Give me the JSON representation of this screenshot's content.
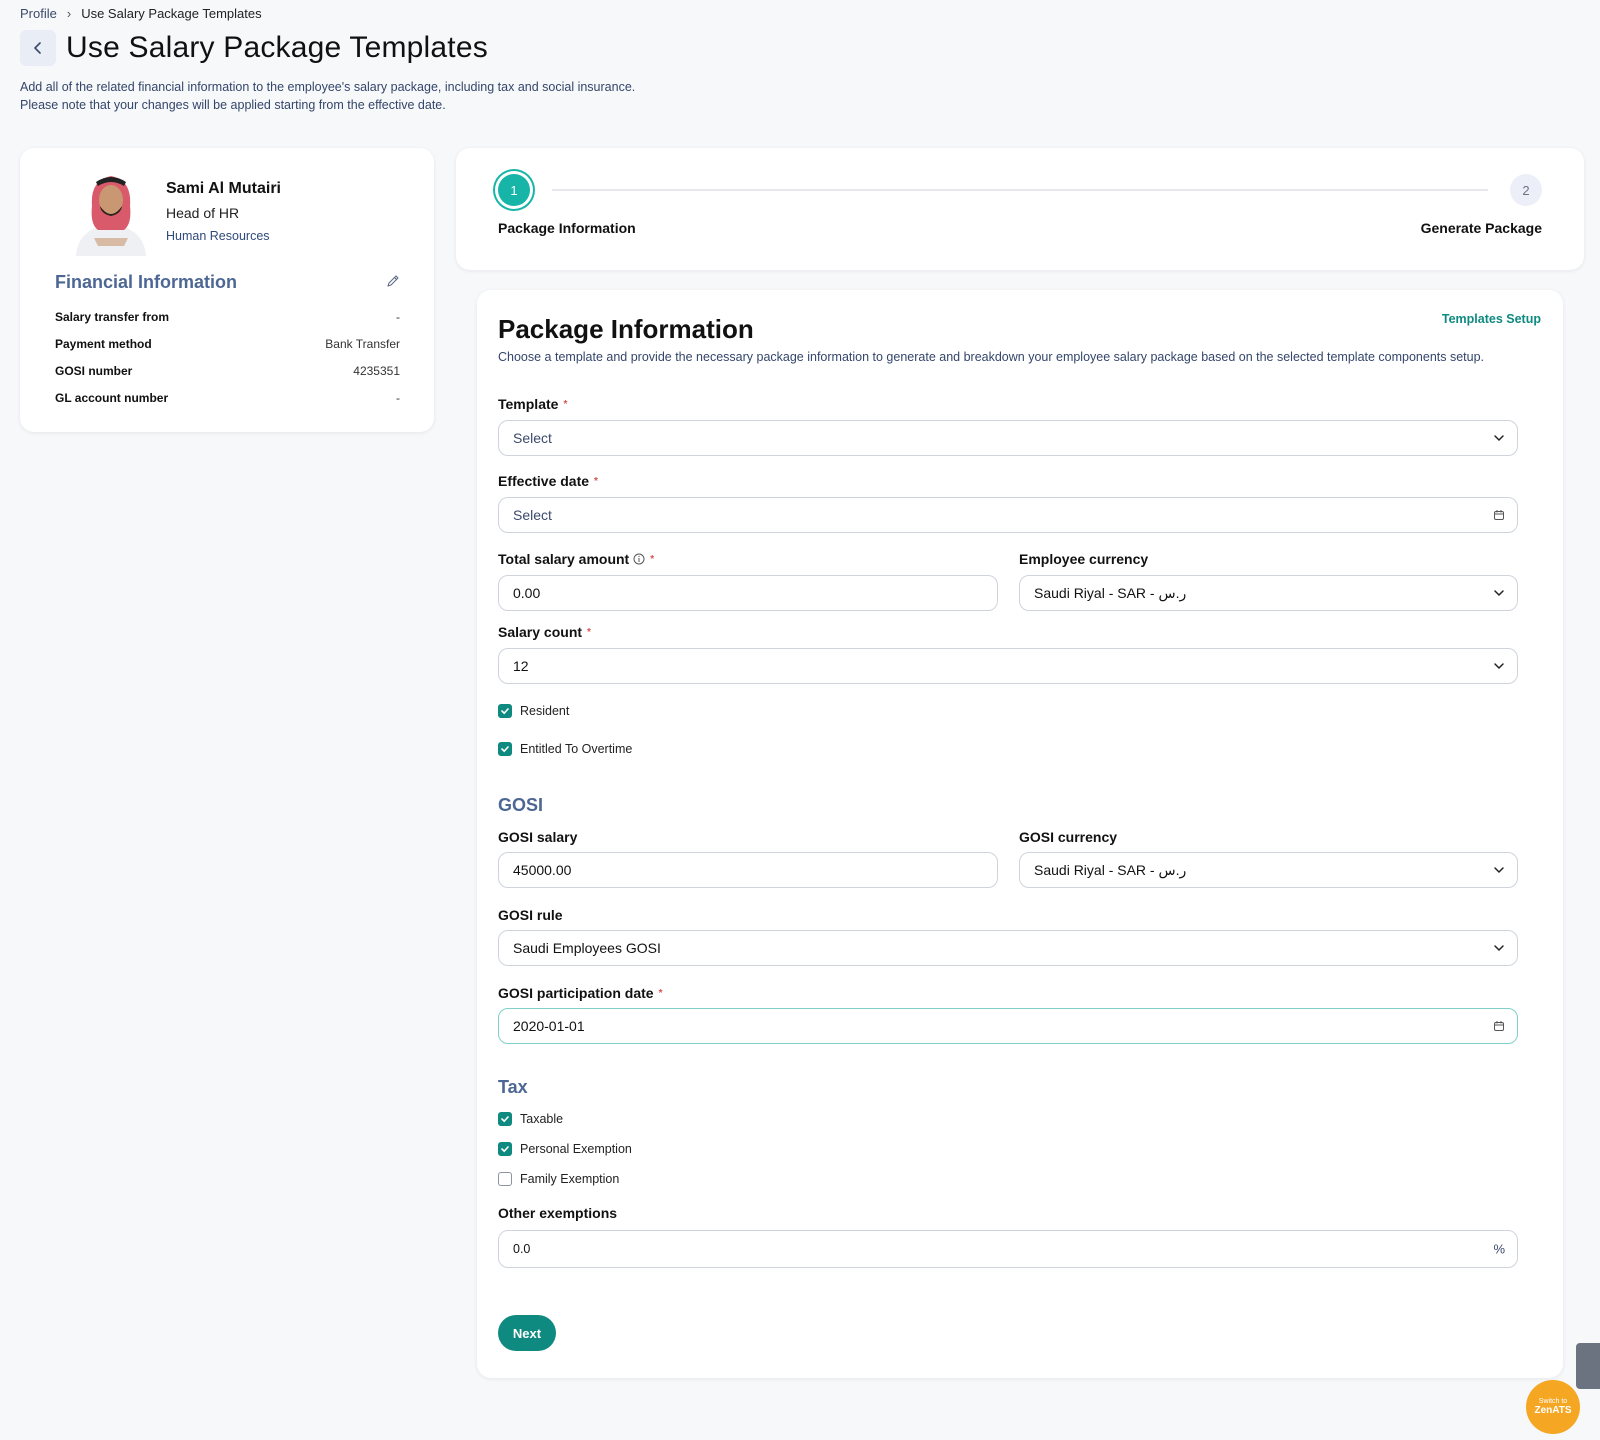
{
  "breadcrumb": {
    "parent": "Profile",
    "separator": "›",
    "current": "Use Salary Package Templates"
  },
  "page": {
    "title": "Use Salary Package Templates",
    "description": "Add all of the related financial information to the employee's salary package, including tax and social insurance. Please note that your changes will be applied starting from the effective date."
  },
  "employee": {
    "name": "Sami Al Mutairi",
    "role": "Head of HR",
    "department": "Human Resources"
  },
  "financial": {
    "title": "Financial Information",
    "rows": [
      {
        "label": "Salary transfer from",
        "value": "-"
      },
      {
        "label": "Payment method",
        "value": "Bank Transfer"
      },
      {
        "label": "GOSI number",
        "value": "4235351"
      },
      {
        "label": "GL account number",
        "value": "-"
      }
    ]
  },
  "stepper": {
    "steps": [
      {
        "number": "1",
        "label": "Package Information"
      },
      {
        "number": "2",
        "label": "Generate Package"
      }
    ]
  },
  "form": {
    "title": "Package Information",
    "templates_link": "Templates Setup",
    "description": "Choose a template and provide the necessary package information to generate and breakdown your employee salary package based on the selected template components setup.",
    "template": {
      "label": "Template",
      "placeholder": "Select"
    },
    "effective_date": {
      "label": "Effective date",
      "placeholder": "Select"
    },
    "total_salary": {
      "label": "Total salary amount",
      "value": "0.00"
    },
    "employee_currency": {
      "label": "Employee currency",
      "value": "Saudi Riyal - SAR - ر.س"
    },
    "salary_count": {
      "label": "Salary count",
      "value": "12"
    },
    "resident": {
      "label": "Resident",
      "checked": true
    },
    "overtime": {
      "label": "Entitled To Overtime",
      "checked": true
    },
    "gosi": {
      "title": "GOSI",
      "salary": {
        "label": "GOSI salary",
        "value": "45000.00"
      },
      "currency": {
        "label": "GOSI currency",
        "value": "Saudi Riyal - SAR - ر.س"
      },
      "rule": {
        "label": "GOSI rule",
        "value": "Saudi Employees GOSI"
      },
      "participation_date": {
        "label": "GOSI participation date",
        "value": "2020-01-01"
      }
    },
    "tax": {
      "title": "Tax",
      "taxable": {
        "label": "Taxable",
        "checked": true
      },
      "personal_exemption": {
        "label": "Personal Exemption",
        "checked": true
      },
      "family_exemption": {
        "label": "Family Exemption",
        "checked": false
      }
    },
    "other_exemptions": {
      "label": "Other exemptions",
      "value": "0.0",
      "suffix": "%"
    },
    "next_label": "Next"
  },
  "switch_widget": {
    "line1": "Switch to",
    "line2": "ZenATS"
  },
  "colors": {
    "accent": "#0f8a80",
    "step_active": "#17b5a7",
    "section": "#4d6794",
    "widget": "#f5a623"
  }
}
